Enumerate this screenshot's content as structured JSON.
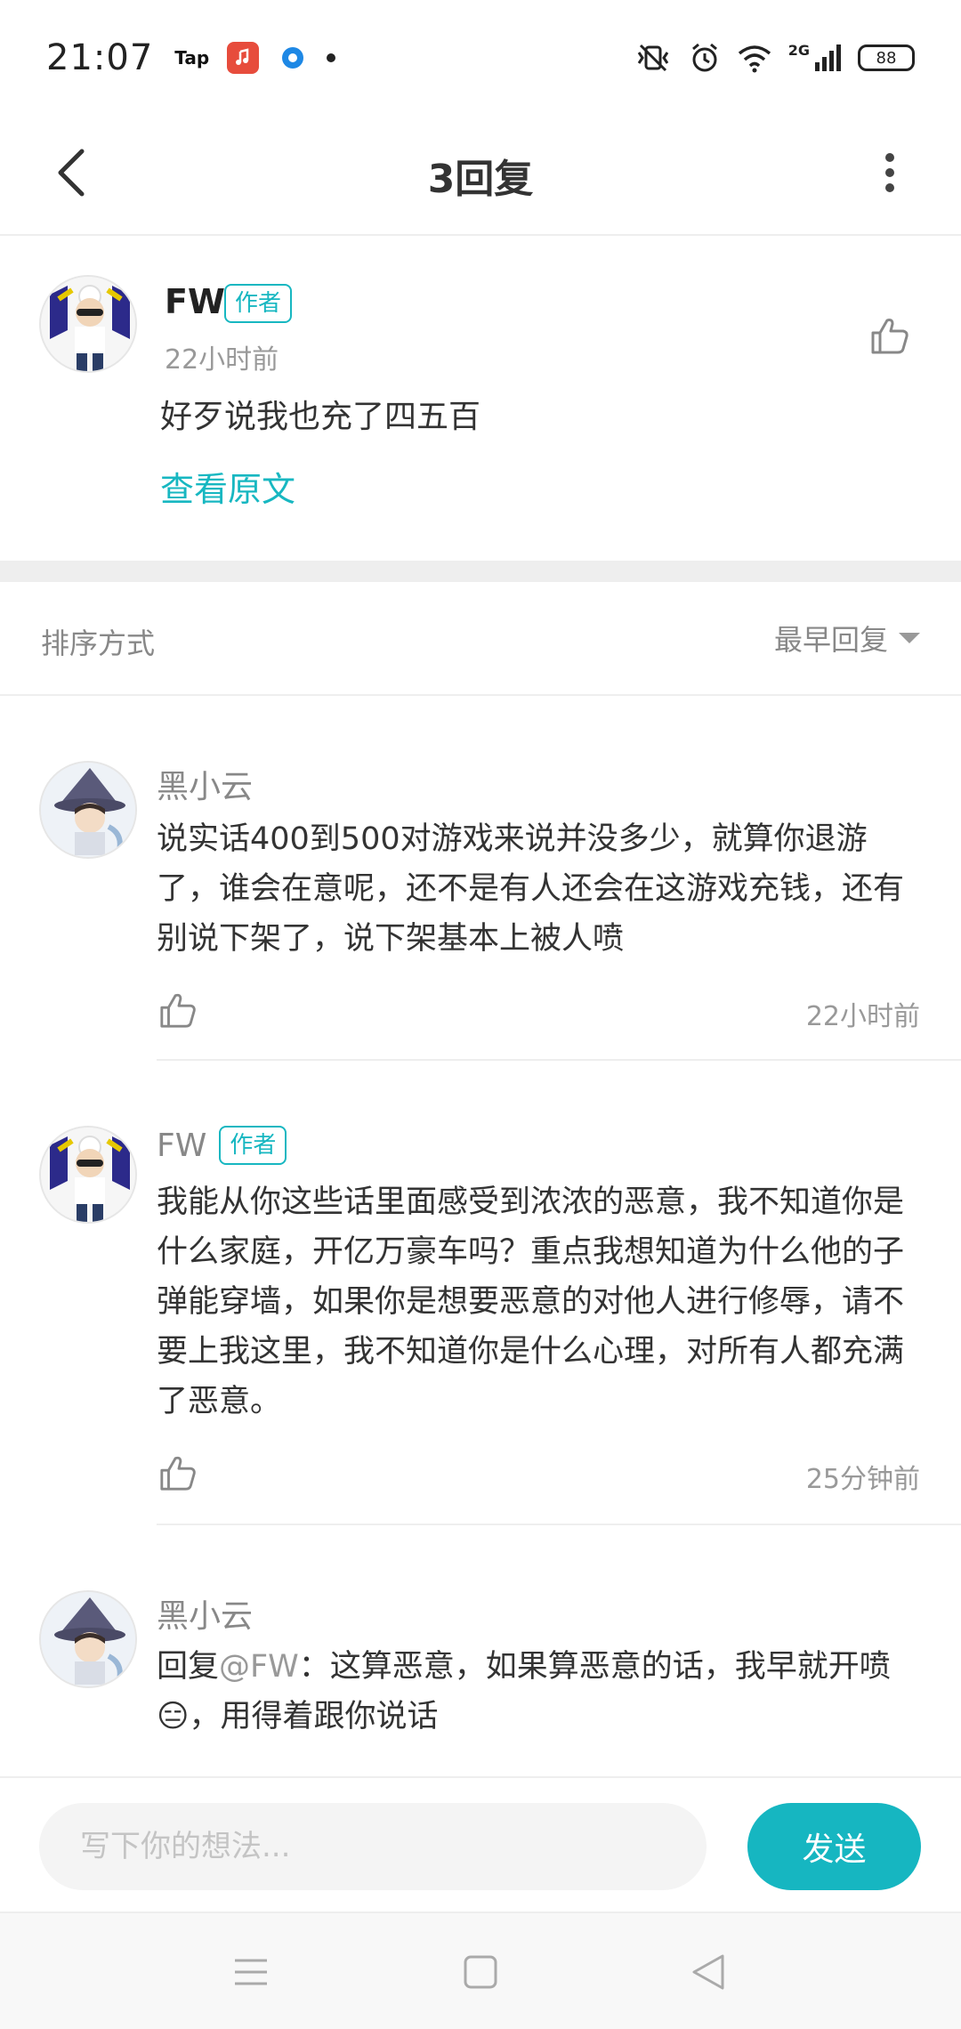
{
  "status_bar": {
    "time": "21:07",
    "left_icons": [
      "tap-app-icon",
      "music-app-icon",
      "ring-app-icon",
      "notification-dot"
    ],
    "tap_label": "Tap",
    "network_label": "2G",
    "battery": "88"
  },
  "header": {
    "title": "3回复"
  },
  "original_post": {
    "author": "FW",
    "author_tag": "作者",
    "time": "22小时前",
    "text": "好歹说我也充了四五百",
    "view_original": "查看原文"
  },
  "sort": {
    "label": "排序方式",
    "selected": "最早回复"
  },
  "replies": [
    {
      "author": "黑小云",
      "text": "说实话400到500对游戏来说并没多少，就算你退游了，谁会在意呢，还不是有人还会在这游戏充钱，还有别说下架了，说下架基本上被人喷",
      "time": "22小时前"
    },
    {
      "author": "FW",
      "author_tag": "作者",
      "text": "我能从你这些话里面感受到浓浓的恶意，我不知道你是什么家庭，开亿万豪车吗？重点我想知道为什么他的子弹能穿墙，如果你是想要恶意的对他人进行修辱，请不要上我这里，我不知道你是什么心理，对所有人都充满了恶意。",
      "time": "25分钟前"
    },
    {
      "author": "黑小云",
      "reply_prefix": "回复",
      "mention": "@FW",
      "text": "：这算恶意，如果算恶意的话，我早就开喷😑，用得着跟你说话"
    }
  ],
  "input": {
    "placeholder": "写下你的想法...",
    "send_label": "发送"
  },
  "colors": {
    "accent": "#16b6c1",
    "muted_text": "#999999",
    "divider": "#eeeeee"
  }
}
